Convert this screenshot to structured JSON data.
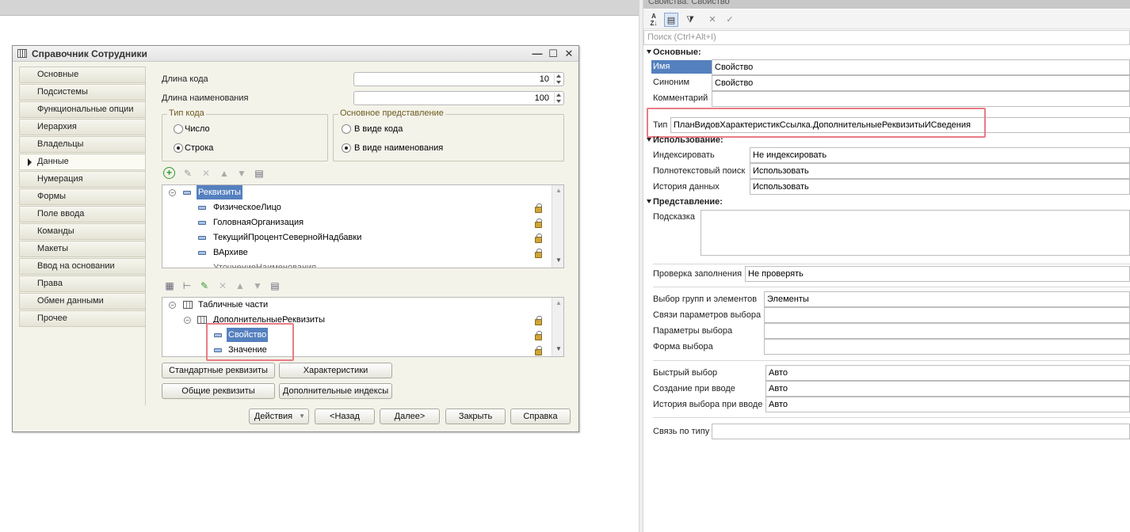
{
  "dialog": {
    "title": "Справочник Сотрудники",
    "window_buttons": {
      "minimize": "—",
      "maximize": "☐",
      "close": "✕"
    },
    "nav_items": [
      "Основные",
      "Подсистемы",
      "Функциональные опции",
      "Иерархия",
      "Владельцы",
      "Данные",
      "Нумерация",
      "Формы",
      "Поле ввода",
      "Команды",
      "Макеты",
      "Ввод на основании",
      "Права",
      "Обмен данными",
      "Прочее"
    ],
    "active_nav": "Данные",
    "code_length": {
      "label": "Длина кода",
      "value": "10"
    },
    "name_length": {
      "label": "Длина наименования",
      "value": "100"
    },
    "code_type": {
      "title": "Тип кода",
      "option1": "Число",
      "option2": "Строка",
      "selected": "Строка"
    },
    "main_repr": {
      "title": "Основное представление",
      "option1": "В виде кода",
      "option2": "В виде наименования",
      "selected": "В виде наименования"
    },
    "attributes_tree": {
      "root": "Реквизиты",
      "items": [
        "ФизическоеЛицо",
        "ГоловнаяОрганизация",
        "ТекущийПроцентСевернойНадбавки",
        "ВАрхиве",
        "УточнениеНаименования"
      ]
    },
    "tabular_tree": {
      "root": "Табличные части",
      "part": "ДополнительныеРеквизиты",
      "items": [
        "Свойство",
        "Значение"
      ]
    },
    "buttons": {
      "standard_attrs": "Стандартные реквизиты",
      "characteristics": "Характеристики",
      "common_attrs": "Общие реквизиты",
      "extra_indexes": "Дополнительные индексы",
      "actions": "Действия",
      "back": "<Назад",
      "next": "Далее>",
      "close": "Закрыть",
      "help": "Справка"
    }
  },
  "properties": {
    "title": "Свойства: Свойство",
    "search_placeholder": "Поиск (Ctrl+Alt+I)",
    "sections": {
      "main": "Основные:",
      "usage": "Использование:",
      "presentation": "Представление:"
    },
    "name": {
      "label": "Имя",
      "value": "Свойство"
    },
    "synonym": {
      "label": "Синоним",
      "value": "Свойство"
    },
    "comment": {
      "label": "Комментарий",
      "value": ""
    },
    "type": {
      "label": "Тип",
      "value": "ПланВидовХарактеристикСсылка.ДополнительныеРеквизитыИСведения"
    },
    "indexing": {
      "label": "Индексировать",
      "value": "Не индексировать"
    },
    "fulltext": {
      "label": "Полнотекстовый поиск",
      "value": "Использовать"
    },
    "history": {
      "label": "История данных",
      "value": "Использовать"
    },
    "tooltip": {
      "label": "Подсказка",
      "value": ""
    },
    "fill_check": {
      "label": "Проверка заполнения",
      "value": "Не проверять"
    },
    "groups_select": {
      "label": "Выбор групп и элементов",
      "value": "Элементы"
    },
    "choice_links": {
      "label": "Связи параметров выбора",
      "value": ""
    },
    "choice_params": {
      "label": "Параметры выбора",
      "value": ""
    },
    "choice_form": {
      "label": "Форма выбора",
      "value": ""
    },
    "quick_choice": {
      "label": "Быстрый выбор",
      "value": "Авто"
    },
    "create_on_input": {
      "label": "Создание при вводе",
      "value": "Авто"
    },
    "choice_history": {
      "label": "История выбора при вводе",
      "value": "Авто"
    },
    "type_link": {
      "label": "Связь по типу",
      "value": ""
    }
  },
  "colors": {
    "selection": "#5580bf",
    "highlight_box": "#e87c84"
  }
}
